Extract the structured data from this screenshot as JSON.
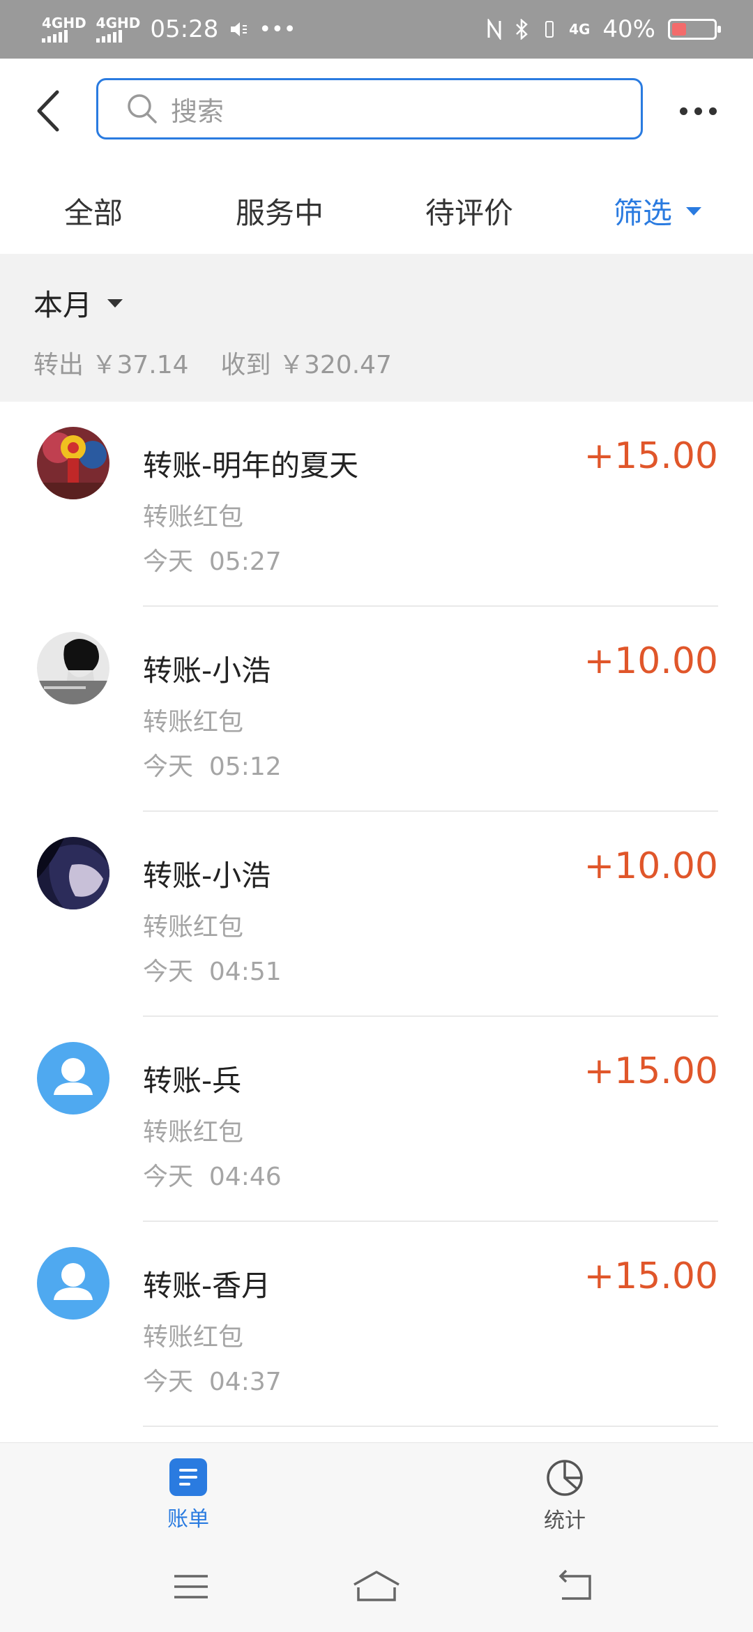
{
  "status_bar": {
    "network1": "4GHD",
    "network2": "4GHD",
    "time": "05:28",
    "network3": "4G",
    "battery_percent": "40%",
    "battery_level": 0.4
  },
  "header": {
    "search_placeholder": "搜索"
  },
  "tabs": [
    {
      "label": "全部"
    },
    {
      "label": "服务中"
    },
    {
      "label": "待评价"
    },
    {
      "label": "筛选",
      "active": true
    }
  ],
  "month": {
    "title": "本月",
    "out_label": "转出",
    "out_amount": "￥37.14",
    "in_label": "收到",
    "in_amount": "￥320.47"
  },
  "transactions": [
    {
      "title": "转账-明年的夏天",
      "type": "转账红包",
      "day": "今天",
      "time": "05:27",
      "amount": "+15.00",
      "avatar": "photo-toy"
    },
    {
      "title": "转账-小浩",
      "type": "转账红包",
      "day": "今天",
      "time": "05:12",
      "amount": "+10.00",
      "avatar": "photo-bw"
    },
    {
      "title": "转账-小浩",
      "type": "转账红包",
      "day": "今天",
      "time": "04:51",
      "amount": "+10.00",
      "avatar": "photo-dark"
    },
    {
      "title": "转账-兵",
      "type": "转账红包",
      "day": "今天",
      "time": "04:46",
      "amount": "+15.00",
      "avatar": "default-user"
    },
    {
      "title": "转账-香月",
      "type": "转账红包",
      "day": "今天",
      "time": "04:37",
      "amount": "+15.00",
      "avatar": "default-user"
    }
  ],
  "bottom_nav": {
    "bills_label": "账单",
    "stats_label": "统计"
  },
  "colors": {
    "accent": "#2a7be0",
    "amount": "#e0562a",
    "default_avatar": "#4fa9f0"
  }
}
